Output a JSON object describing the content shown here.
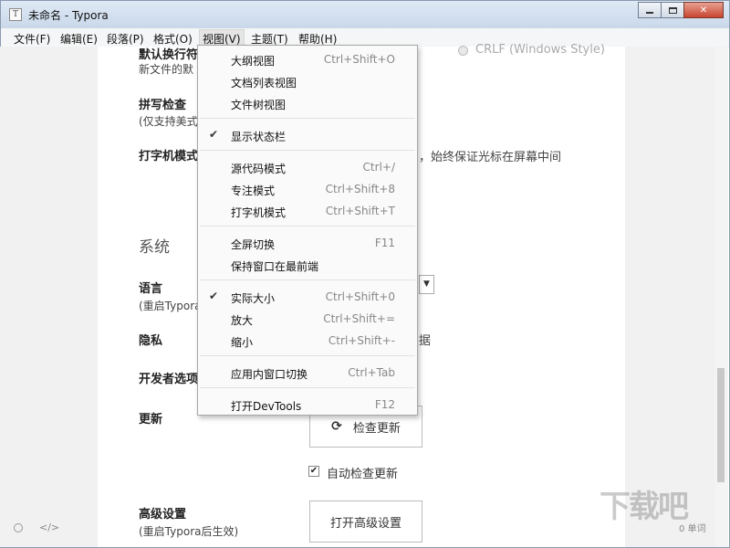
{
  "window": {
    "title": "未命名 - Typora",
    "app_icon_letter": "T"
  },
  "menubar": {
    "items": [
      "文件(F)",
      "编辑(E)",
      "段落(P)",
      "格式(O)",
      "视图(V)",
      "主题(T)",
      "帮助(H)"
    ],
    "active": "视图(V)"
  },
  "settings": {
    "line_ending": {
      "label": "默认换行符",
      "desc": "新文件的默",
      "crlf_label": "CRLF (Windows Style)"
    },
    "spellcheck": {
      "label": "拼写检查",
      "desc": "(仅支持美式"
    },
    "typewriter": {
      "label": "打字机模式",
      "desc_tail": "，始终保证光标在屏幕中间"
    },
    "system_section": "系统",
    "language": {
      "label": "语言",
      "desc": "(重启Typora"
    },
    "privacy": {
      "label": "隐私",
      "tail": "据"
    },
    "developer": {
      "label": "开发者选项"
    },
    "update": {
      "label": "更新",
      "check_button": "检查更新",
      "auto_check": "自动检查更新"
    },
    "advanced": {
      "label": "高级设置",
      "desc": "(重启Typora后生效)",
      "button": "打开高级设置"
    }
  },
  "view_menu": {
    "items": [
      {
        "label": "大纲视图",
        "shortcut": "Ctrl+Shift+O",
        "checked": false
      },
      {
        "label": "文档列表视图",
        "shortcut": "",
        "checked": false
      },
      {
        "label": "文件树视图",
        "shortcut": "",
        "checked": false
      },
      {
        "label": "显示状态栏",
        "shortcut": "",
        "checked": true
      },
      {
        "label": "源代码模式",
        "shortcut": "Ctrl+/",
        "checked": false
      },
      {
        "label": "专注模式",
        "shortcut": "Ctrl+Shift+8",
        "checked": false
      },
      {
        "label": "打字机模式",
        "shortcut": "Ctrl+Shift+T",
        "checked": false
      },
      {
        "label": "全屏切换",
        "shortcut": "F11",
        "checked": false
      },
      {
        "label": "保持窗口在最前端",
        "shortcut": "",
        "checked": false
      },
      {
        "label": "实际大小",
        "shortcut": "Ctrl+Shift+0",
        "checked": true
      },
      {
        "label": "放大",
        "shortcut": "Ctrl+Shift+=",
        "checked": false
      },
      {
        "label": "缩小",
        "shortcut": "Ctrl+Shift+-",
        "checked": false
      },
      {
        "label": "应用内窗口切换",
        "shortcut": "Ctrl+Tab",
        "checked": false
      },
      {
        "label": "打开DevTools",
        "shortcut": "F12",
        "checked": false
      }
    ]
  },
  "statusbar": {
    "code_icon": "</>",
    "word_count": "0 单词"
  },
  "watermark": "下载吧",
  "colors": {
    "titlebar": "#d4e1f0",
    "close_button": "#c8452f",
    "menu_highlight": "#e5e5e5"
  }
}
